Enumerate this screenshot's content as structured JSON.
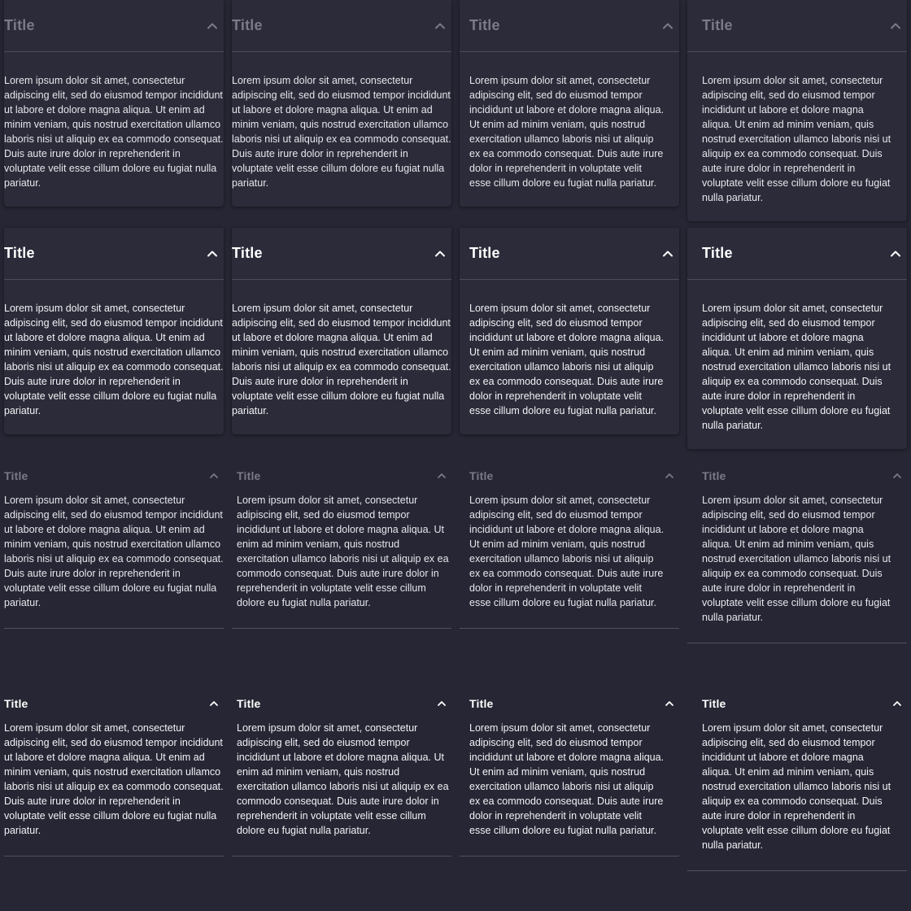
{
  "rows": [
    {
      "state": "disabled",
      "variant": "card",
      "items": [
        {
          "title": "Title",
          "content": "Lorem ipsum dolor sit amet, consectetur adipiscing elit, sed do eiusmod tempor incididunt ut labore et dolore magna aliqua. Ut enim ad minim veniam, quis nostrud exercitation ullamco laboris nisi ut aliquip ex ea commodo consequat. Duis aute irure dolor in reprehenderit in voluptate velit esse cillum dolore eu fugiat nulla pariatur.",
          "icon": "chevron-up-icon"
        },
        {
          "title": "Title",
          "content": "Lorem ipsum dolor sit amet, consectetur adipiscing elit, sed do eiusmod tempor incididunt ut labore et dolore magna aliqua. Ut enim ad minim veniam, quis nostrud exercitation ullamco laboris nisi ut aliquip ex ea commodo consequat. Duis aute irure dolor in reprehenderit in voluptate velit esse cillum dolore eu fugiat nulla pariatur.",
          "icon": "chevron-up-icon"
        },
        {
          "title": "Title",
          "content": "Lorem ipsum dolor sit amet, consectetur adipiscing elit, sed do eiusmod tempor incididunt ut labore et dolore magna aliqua. Ut enim ad minim veniam, quis nostrud exercitation ullamco laboris nisi ut aliquip ex ea commodo consequat. Duis aute irure dolor in reprehenderit in voluptate velit esse cillum dolore eu fugiat nulla pariatur.",
          "icon": "chevron-up-icon"
        },
        {
          "title": "Title",
          "content": "Lorem ipsum dolor sit amet, consectetur adipiscing elit, sed do eiusmod tempor incididunt ut labore et dolore magna aliqua. Ut enim ad minim veniam, quis nostrud exercitation ullamco laboris nisi ut aliquip ex ea commodo consequat. Duis aute irure dolor in reprehenderit in voluptate velit esse cillum dolore eu fugiat nulla pariatur.",
          "icon": "chevron-up-icon"
        }
      ]
    },
    {
      "state": "enabled",
      "variant": "card",
      "items": [
        {
          "title": "Title",
          "content": "Lorem ipsum dolor sit amet, consectetur adipiscing elit, sed do eiusmod tempor incididunt ut labore et dolore magna aliqua. Ut enim ad minim veniam, quis nostrud exercitation ullamco laboris nisi ut aliquip ex ea commodo consequat. Duis aute irure dolor in reprehenderit in voluptate velit esse cillum dolore eu fugiat nulla pariatur.",
          "icon": "chevron-up-icon"
        },
        {
          "title": "Title",
          "content": "Lorem ipsum dolor sit amet, consectetur adipiscing elit, sed do eiusmod tempor incididunt ut labore et dolore magna aliqua. Ut enim ad minim veniam, quis nostrud exercitation ullamco laboris nisi ut aliquip ex ea commodo consequat. Duis aute irure dolor in reprehenderit in voluptate velit esse cillum dolore eu fugiat nulla pariatur.",
          "icon": "chevron-up-icon"
        },
        {
          "title": "Title",
          "content": "Lorem ipsum dolor sit amet, consectetur adipiscing elit, sed do eiusmod tempor incididunt ut labore et dolore magna aliqua. Ut enim ad minim veniam, quis nostrud exercitation ullamco laboris nisi ut aliquip ex ea commodo consequat. Duis aute irure dolor in reprehenderit in voluptate velit esse cillum dolore eu fugiat nulla pariatur.",
          "icon": "chevron-up-icon"
        },
        {
          "title": "Title",
          "content": "Lorem ipsum dolor sit amet, consectetur adipiscing elit, sed do eiusmod tempor incididunt ut labore et dolore magna aliqua. Ut enim ad minim veniam, quis nostrud exercitation ullamco laboris nisi ut aliquip ex ea commodo consequat. Duis aute irure dolor in reprehenderit in voluptate velit esse cillum dolore eu fugiat nulla pariatur.",
          "icon": "chevron-up-icon"
        }
      ]
    },
    {
      "state": "disabled",
      "variant": "flat",
      "items": [
        {
          "title": "Title",
          "content": "Lorem ipsum dolor sit amet, consectetur adipiscing elit, sed do eiusmod tempor incididunt ut labore et dolore magna aliqua. Ut enim ad minim veniam, quis nostrud exercitation ullamco laboris nisi ut aliquip ex ea commodo consequat. Duis aute irure dolor in reprehenderit in voluptate velit esse cillum dolore eu fugiat nulla pariatur.",
          "icon": "chevron-up-icon"
        },
        {
          "title": "Title",
          "content": "Lorem ipsum dolor sit amet, consectetur adipiscing elit, sed do eiusmod tempor incididunt ut labore et dolore magna aliqua. Ut enim ad minim veniam, quis nostrud exercitation ullamco laboris nisi ut aliquip ex ea commodo consequat. Duis aute irure dolor in reprehenderit in voluptate velit esse cillum dolore eu fugiat nulla pariatur.",
          "icon": "chevron-up-icon"
        },
        {
          "title": "Title",
          "content": "Lorem ipsum dolor sit amet, consectetur adipiscing elit, sed do eiusmod tempor incididunt ut labore et dolore magna aliqua. Ut enim ad minim veniam, quis nostrud exercitation ullamco laboris nisi ut aliquip ex ea commodo consequat. Duis aute irure dolor in reprehenderit in voluptate velit esse cillum dolore eu fugiat nulla pariatur.",
          "icon": "chevron-up-icon"
        },
        {
          "title": "Title",
          "content": "Lorem ipsum dolor sit amet, consectetur adipiscing elit, sed do eiusmod tempor incididunt ut labore et dolore magna aliqua. Ut enim ad minim veniam, quis nostrud exercitation ullamco laboris nisi ut aliquip ex ea commodo consequat. Duis aute irure dolor in reprehenderit in voluptate velit esse cillum dolore eu fugiat nulla pariatur.",
          "icon": "chevron-up-icon"
        }
      ]
    },
    {
      "state": "enabled",
      "variant": "flat",
      "items": [
        {
          "title": "Title",
          "content": "Lorem ipsum dolor sit amet, consectetur adipiscing elit, sed do eiusmod tempor incididunt ut labore et dolore magna aliqua. Ut enim ad minim veniam, quis nostrud exercitation ullamco laboris nisi ut aliquip ex ea commodo consequat. Duis aute irure dolor in reprehenderit in voluptate velit esse cillum dolore eu fugiat nulla pariatur.",
          "icon": "chevron-up-icon"
        },
        {
          "title": "Title",
          "content": "Lorem ipsum dolor sit amet, consectetur adipiscing elit, sed do eiusmod tempor incididunt ut labore et dolore magna aliqua. Ut enim ad minim veniam, quis nostrud exercitation ullamco laboris nisi ut aliquip ex ea commodo consequat. Duis aute irure dolor in reprehenderit in voluptate velit esse cillum dolore eu fugiat nulla pariatur.",
          "icon": "chevron-up-icon"
        },
        {
          "title": "Title",
          "content": "Lorem ipsum dolor sit amet, consectetur adipiscing elit, sed do eiusmod tempor incididunt ut labore et dolore magna aliqua. Ut enim ad minim veniam, quis nostrud exercitation ullamco laboris nisi ut aliquip ex ea commodo consequat. Duis aute irure dolor in reprehenderit in voluptate velit esse cillum dolore eu fugiat nulla pariatur.",
          "icon": "chevron-up-icon"
        },
        {
          "title": "Title",
          "content": "Lorem ipsum dolor sit amet, consectetur adipiscing elit, sed do eiusmod tempor incididunt ut labore et dolore magna aliqua. Ut enim ad minim veniam, quis nostrud exercitation ullamco laboris nisi ut aliquip ex ea commodo consequat. Duis aute irure dolor in reprehenderit in voluptate velit esse cillum dolore eu fugiat nulla pariatur.",
          "icon": "chevron-up-icon"
        }
      ]
    }
  ],
  "colors": {
    "background": "#262634",
    "card": "#2b2b39",
    "divider": "#4d4d5a",
    "text": "#ffffff",
    "muted_title": "#7a7a88"
  }
}
